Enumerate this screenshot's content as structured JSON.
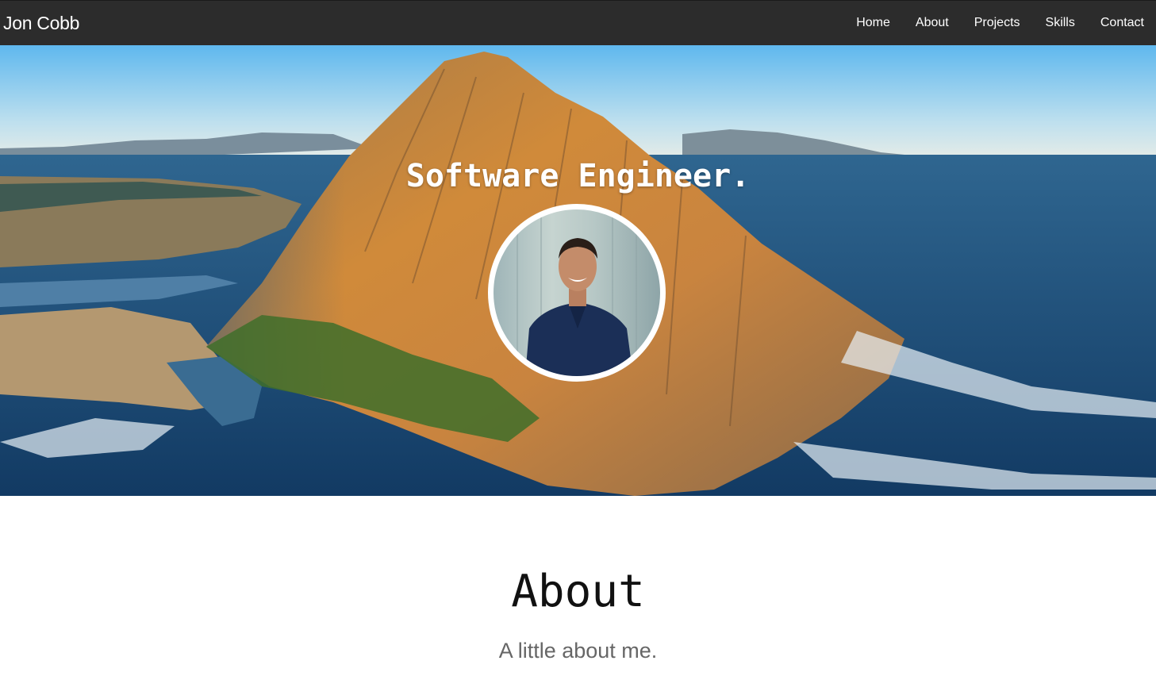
{
  "navbar": {
    "brand": "Jon Cobb",
    "links": [
      "Home",
      "About",
      "Projects",
      "Skills",
      "Contact"
    ]
  },
  "hero": {
    "title": "Software Engineer.",
    "avatar_icon": "profile-photo"
  },
  "about": {
    "heading": "About",
    "subheading": "A little about me."
  },
  "colors": {
    "navbar_bg": "#2c2c2c",
    "avatar_border": "#ffffff",
    "subheading_text": "#666666"
  }
}
